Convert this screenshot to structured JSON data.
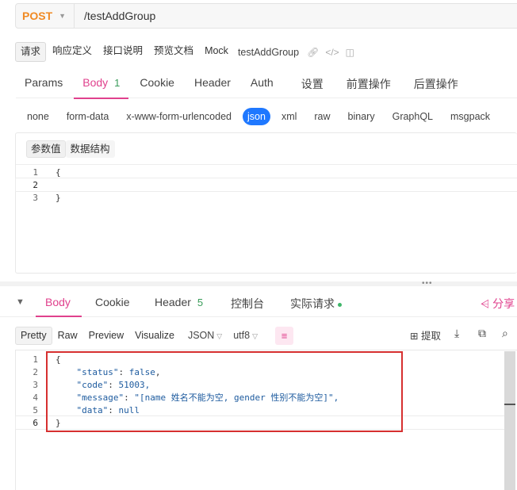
{
  "request": {
    "method": "POST",
    "url": "/testAddGroup"
  },
  "doc_tabs": [
    {
      "label": "请求",
      "active": true
    },
    {
      "label": "响应定义",
      "active": false
    },
    {
      "label": "接口说明",
      "active": false
    },
    {
      "label": "预览文档",
      "active": false
    },
    {
      "label": "Mock",
      "active": false
    }
  ],
  "doc_name": "testAddGroup",
  "req_tabs": [
    {
      "label": "Params",
      "active": false,
      "badge": ""
    },
    {
      "label": "Body",
      "active": true,
      "badge": "1"
    },
    {
      "label": "Cookie",
      "active": false,
      "badge": ""
    },
    {
      "label": "Header",
      "active": false,
      "badge": ""
    },
    {
      "label": "Auth",
      "active": false,
      "badge": ""
    },
    {
      "label": "设置",
      "active": false,
      "badge": ""
    },
    {
      "label": "前置操作",
      "active": false,
      "badge": ""
    },
    {
      "label": "后置操作",
      "active": false,
      "badge": ""
    }
  ],
  "body_types": [
    "none",
    "form-data",
    "x-www-form-urlencoded",
    "json",
    "xml",
    "raw",
    "binary",
    "GraphQL",
    "msgpack"
  ],
  "body_type_selected": "json",
  "editor_tabs": [
    {
      "label": "参数值",
      "active": true
    },
    {
      "label": "数据结构",
      "active": false
    }
  ],
  "request_body_lines": [
    {
      "num": "1",
      "text": "{"
    },
    {
      "num": "2",
      "text": ""
    },
    {
      "num": "3",
      "text": "}"
    }
  ],
  "resp_tabs": {
    "body": "Body",
    "cookie": "Cookie",
    "header": "Header",
    "header_badge": "5",
    "console": "控制台",
    "actual": "实际请求"
  },
  "share_label": "分享",
  "resp_toolbar": {
    "pretty": "Pretty",
    "raw": "Raw",
    "preview": "Preview",
    "visualize": "Visualize",
    "format": "JSON",
    "encoding": "utf8",
    "extract": "提取"
  },
  "response_lines": [
    {
      "num": "1",
      "text": "{"
    },
    {
      "num": "2",
      "key": "\"status\"",
      "value": "false"
    },
    {
      "num": "3",
      "key": "\"code\"",
      "value": "51003,"
    },
    {
      "num": "4",
      "key": "\"message\"",
      "value": "\"[name 姓名不能为空, gender 性别不能为空]\","
    },
    {
      "num": "5",
      "key": "\"data\"",
      "value": "null"
    },
    {
      "num": "6",
      "text": "}"
    }
  ],
  "colors": {
    "accent": "#e0418d",
    "method": "#f08a24",
    "selected_type": "#1f78ff",
    "highlight_box": "#d63030"
  }
}
